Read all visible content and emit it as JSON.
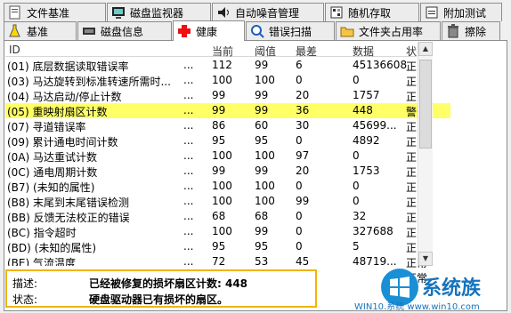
{
  "tabs_back": [
    {
      "label": "文件基准",
      "icon": "file-benchmark-icon"
    },
    {
      "label": "磁盘监视器",
      "icon": "disk-monitor-icon"
    },
    {
      "label": "自动噪音管理",
      "icon": "noise-icon"
    },
    {
      "label": "随机存取",
      "icon": "random-access-icon"
    },
    {
      "label": "附加测试",
      "icon": "extra-tests-icon"
    }
  ],
  "tabs_front": [
    {
      "label": "基准",
      "icon": "benchmark-icon"
    },
    {
      "label": "磁盘信息",
      "icon": "disk-info-icon"
    },
    {
      "label": "健康",
      "icon": "health-cross-icon"
    },
    {
      "label": "错误扫描",
      "icon": "error-scan-icon"
    },
    {
      "label": "文件夹占用率",
      "icon": "folder-usage-icon"
    },
    {
      "label": "擦除",
      "icon": "erase-trash-icon"
    }
  ],
  "active_tab": "健康",
  "columns": [
    "ID",
    "当前",
    "阈值",
    "最差",
    "数据",
    "状态"
  ],
  "rows": [
    {
      "id": "(01) 底层数据读取错误率",
      "cur": "112",
      "thr": "99",
      "wst": "6",
      "data": "45136608",
      "status": "正常"
    },
    {
      "id": "(03) 马达旋转到标准转速所需时...",
      "cur": "100",
      "thr": "100",
      "wst": "0",
      "data": "0",
      "status": "正常"
    },
    {
      "id": "(04) 马达启动/停止计数",
      "cur": "99",
      "thr": "99",
      "wst": "20",
      "data": "1757",
      "status": "正常"
    },
    {
      "id": "(05) 重映射扇区计数",
      "cur": "99",
      "thr": "99",
      "wst": "36",
      "data": "448",
      "status": "警告",
      "highlight": true
    },
    {
      "id": "(07) 寻道错误率",
      "cur": "86",
      "thr": "60",
      "wst": "30",
      "data": "45699...",
      "status": "正常"
    },
    {
      "id": "(09) 累计通电时间计数",
      "cur": "95",
      "thr": "95",
      "wst": "0",
      "data": "4892",
      "status": "正常"
    },
    {
      "id": "(0A) 马达重试计数",
      "cur": "100",
      "thr": "100",
      "wst": "97",
      "data": "0",
      "status": "正常"
    },
    {
      "id": "(0C) 通电周期计数",
      "cur": "99",
      "thr": "99",
      "wst": "20",
      "data": "1753",
      "status": "正常"
    },
    {
      "id": "(B7) (未知的属性)",
      "cur": "100",
      "thr": "100",
      "wst": "0",
      "data": "0",
      "status": "正常"
    },
    {
      "id": "(B8) 末尾到末尾错误检测",
      "cur": "100",
      "thr": "100",
      "wst": "99",
      "data": "0",
      "status": "正常"
    },
    {
      "id": "(BB) 反馈无法校正的错误",
      "cur": "68",
      "thr": "68",
      "wst": "0",
      "data": "32",
      "status": "正常"
    },
    {
      "id": "(BC) 指令超时",
      "cur": "100",
      "thr": "99",
      "wst": "0",
      "data": "327688",
      "status": "正常"
    },
    {
      "id": "(BD) (未知的属性)",
      "cur": "95",
      "thr": "95",
      "wst": "0",
      "data": "5",
      "status": "正常"
    },
    {
      "id": "(BE) 气流温度",
      "cur": "72",
      "thr": "53",
      "wst": "45",
      "data": "48719...",
      "status": "正常"
    },
    {
      "id": "(C2) 温度",
      "cur": "28",
      "thr": "47",
      "wst": "0",
      "data": "28",
      "status": "正常"
    }
  ],
  "dots": "...",
  "description": {
    "desc_label": "描述:",
    "desc_value": "已经被修复的损坏扇区计数: 448",
    "status_label": "状态:",
    "status_value": "硬盘驱动器已有损坏的扇区。"
  },
  "watermark": {
    "title": "系统族",
    "url": "WIN10.系统 www.win10.com"
  },
  "colors": {
    "highlight": "#ffff66",
    "desc_border": "#f2b400",
    "logo_blue": "#1573bd"
  }
}
